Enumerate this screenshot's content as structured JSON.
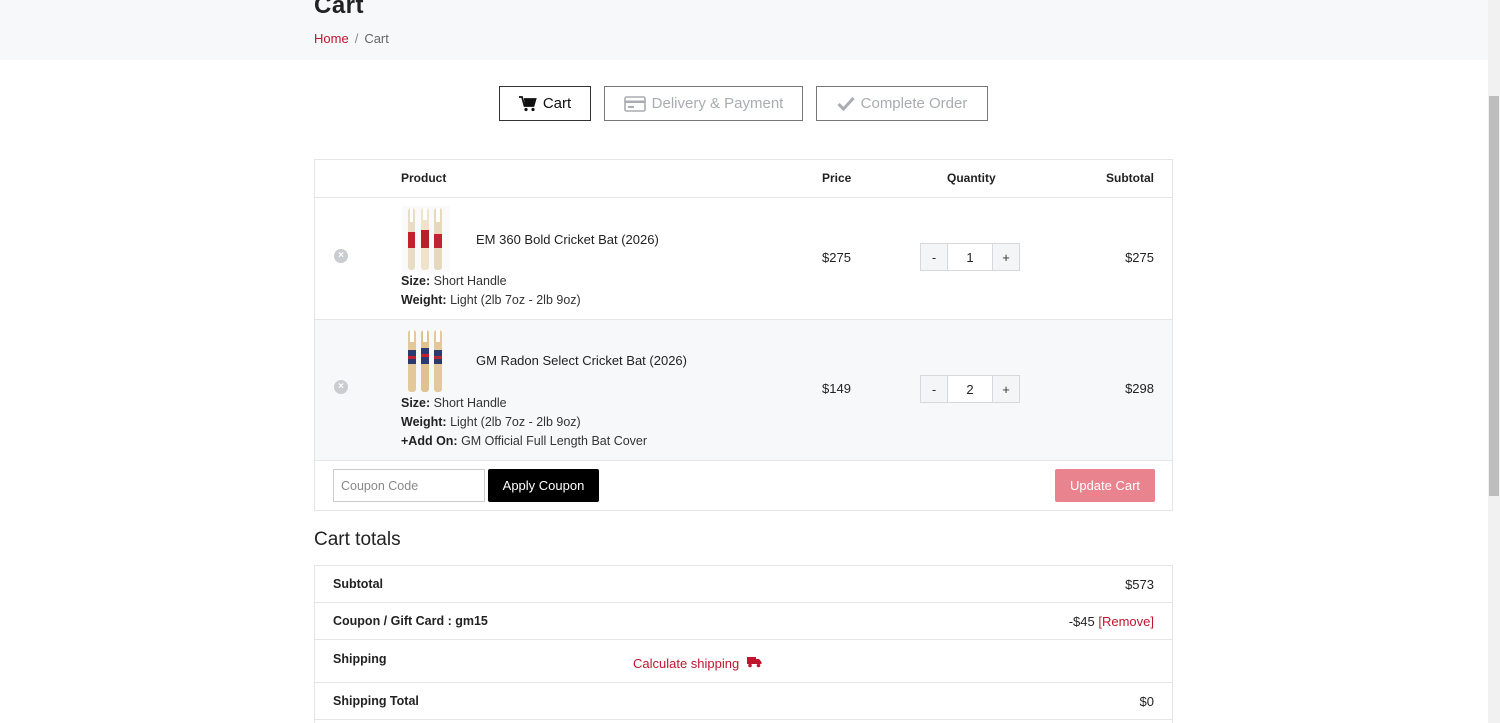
{
  "page": {
    "title": "Cart",
    "breadcrumb": {
      "home": "Home",
      "separator": "/",
      "current": "Cart"
    }
  },
  "steps": [
    {
      "label": "Cart",
      "icon": "cart-icon",
      "state": "active"
    },
    {
      "label": "Delivery & Payment",
      "icon": "credit-card-icon",
      "state": "inactive"
    },
    {
      "label": "Complete Order",
      "icon": "checkmark-icon",
      "state": "inactive"
    }
  ],
  "cart_table": {
    "headers": {
      "product": "Product",
      "price": "Price",
      "quantity": "Quantity",
      "subtotal": "Subtotal"
    },
    "items": [
      {
        "name": "EM 360 Bold Cricket Bat (2026)",
        "size_label": "Size:",
        "size": "Short Handle",
        "weight_label": "Weight:",
        "weight": "Light (2lb 7oz - 2lb 9oz)",
        "price": "$275",
        "quantity": "1",
        "subtotal": "$275"
      },
      {
        "name": "GM Radon Select Cricket Bat (2026)",
        "size_label": "Size:",
        "size": "Short Handle",
        "weight_label": "Weight:",
        "weight": "Light (2lb 7oz - 2lb 9oz)",
        "addon_label": "+Add On:",
        "addon": "GM Official Full Length Bat Cover",
        "price": "$149",
        "quantity": "2",
        "subtotal": "$298"
      }
    ],
    "qty_minus": "-",
    "qty_plus": "+",
    "remove_glyph": "×",
    "coupon_placeholder": "Coupon Code",
    "apply_coupon": "Apply Coupon",
    "update_cart": "Update Cart"
  },
  "totals": {
    "title": "Cart totals",
    "subtotal_label": "Subtotal",
    "subtotal": "$573",
    "coupon_label": "Coupon / Gift Card : gm15",
    "coupon_value": "-$45",
    "coupon_remove": "[Remove]",
    "shipping_label": "Shipping",
    "calculate_shipping": "Calculate shipping",
    "shipping_total_label": "Shipping Total",
    "shipping_total": "$0"
  },
  "colors": {
    "accent": "#c0152f",
    "update_button": "#e9848f",
    "apply_button": "#000000"
  }
}
